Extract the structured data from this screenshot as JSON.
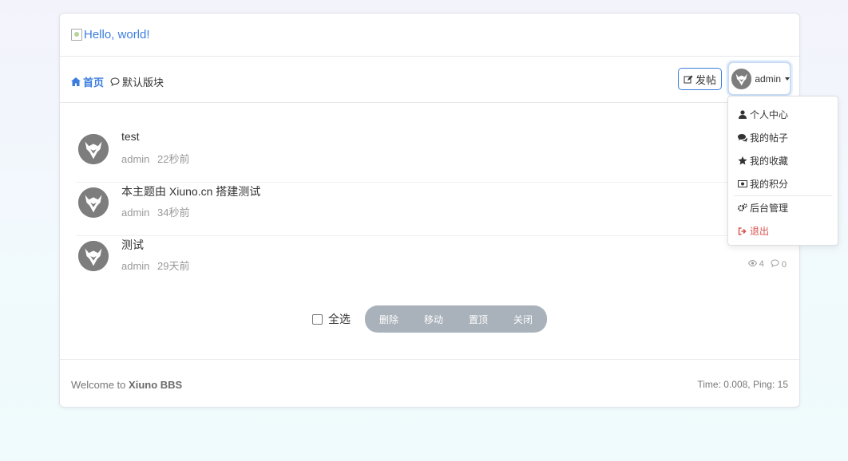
{
  "header": {
    "logo_alt": "Hello, world!"
  },
  "nav": {
    "home": "首页",
    "forum": "默认版块",
    "post_button": "发帖",
    "username": "admin"
  },
  "threads": [
    {
      "title": "test",
      "author": "admin",
      "time": "22秒前"
    },
    {
      "title": "本主题由 Xiuno.cn 搭建测试",
      "author": "admin",
      "time": "34秒前"
    },
    {
      "title": "测试",
      "author": "admin",
      "time": "29天前",
      "views": "4",
      "replies": "0"
    }
  ],
  "toolbar": {
    "select_all": "全选",
    "delete": "删除",
    "move": "移动",
    "pin": "置顶",
    "close": "关闭"
  },
  "footer": {
    "welcome": "Welcome to",
    "brand": "Xiuno BBS",
    "stats": "Time: 0.008, Ping: 15"
  },
  "user_menu": {
    "items": [
      {
        "label": "个人中心",
        "icon": "user-icon"
      },
      {
        "label": "我的帖子",
        "icon": "comments-icon"
      },
      {
        "label": "我的收藏",
        "icon": "star-icon"
      },
      {
        "label": "我的积分",
        "icon": "money-icon"
      },
      {
        "label": "后台管理",
        "icon": "cogs-icon"
      },
      {
        "label": "退出",
        "icon": "sign-out-icon"
      }
    ]
  },
  "colors": {
    "accent": "#3b7ddd",
    "danger": "#d9534f",
    "muted": "#999999",
    "mod_bar": "#a9b1ba"
  }
}
